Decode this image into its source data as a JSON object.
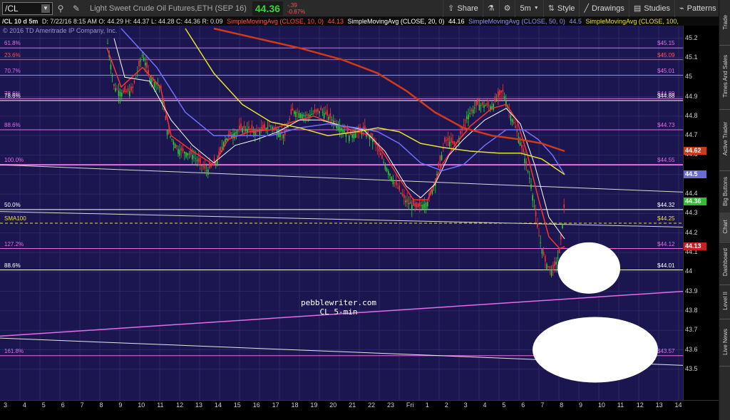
{
  "toolbar": {
    "symbol": "/CL",
    "description": "Light Sweet Crude Oil Futures,ETH (SEP 16)",
    "last": "44.36",
    "change": "-.39",
    "change_pct": "-0.87%",
    "buttons": [
      {
        "icon": "share-icon",
        "label": "Share"
      },
      {
        "icon": "flask-icon",
        "label": ""
      },
      {
        "icon": "gear-icon",
        "label": ""
      },
      {
        "icon": "timeframe",
        "label": "5m"
      },
      {
        "icon": "style-icon",
        "label": "Style"
      },
      {
        "icon": "drawings-icon",
        "label": "Drawings"
      },
      {
        "icon": "studies-icon",
        "label": "Studies"
      },
      {
        "icon": "patterns-icon",
        "label": "Patterns"
      }
    ]
  },
  "studyline": {
    "period": "/CL 10 d 5m",
    "ohlc": "D: 7/22/16 8:15 AM  O: 44.29  H: 44.37  L: 44.28  C: 44.36  R: 0.09",
    "sma10": "SimpleMovingAvg (CLOSE, 10, 0)",
    "sma10_val": "44.13",
    "sma20": "SimpleMovingAvg (CLOSE, 20, 0)",
    "sma20_val": "44.16",
    "sma50": "SimpleMovingAvg (CLOSE, 50, 0)",
    "sma50_val": "44.5",
    "sma100": "SimpleMovingAvg (CLOSE, 100,"
  },
  "copyright": "© 2016 TD Ameritrade IP Company, Inc.",
  "fib_levels": [
    {
      "label": "61.8%",
      "price": "$45.15",
      "color": "#e26de8"
    },
    {
      "label": "23.6%",
      "price": "$45.09",
      "color": "#ff5050"
    },
    {
      "label": "70.7%",
      "price": "$45.01",
      "color": "#e26de8"
    },
    {
      "label": "78.6%",
      "price": "$44.89",
      "color": "#e26de8"
    },
    {
      "label": "78.6%",
      "price": "$44.88",
      "color": "#ffffff"
    },
    {
      "label": "88.6%",
      "price": "$44.73",
      "color": "#e26de8"
    },
    {
      "label": "100.0%",
      "price": "$44.55",
      "color": "#e26de8"
    },
    {
      "label": "50.0%",
      "price": "$44.32",
      "color": "#ffffff"
    },
    {
      "label": "SMA100",
      "price": "$44.25",
      "color": "#e8e030"
    },
    {
      "label": "127.2%",
      "price": "$44.12",
      "color": "#e26de8"
    },
    {
      "label": "88.6%",
      "price": "$44.01",
      "color": "#ffffff"
    },
    {
      "label": "161.8%",
      "price": "$43.57",
      "color": "#e26de8"
    }
  ],
  "watermark": {
    "line1": "pebblewriter.com",
    "line2": "CL 5-min"
  },
  "price_axis": {
    "ticks": [
      "45.2",
      "45.1",
      "45",
      "44.9",
      "44.8",
      "44.7",
      "44.6",
      "44.5",
      "44.4",
      "44.3",
      "44.2",
      "44.1",
      "44",
      "43.9",
      "43.8",
      "43.7",
      "43.6",
      "43.5"
    ],
    "badges": [
      {
        "text": "44.62",
        "bg": "#d03a1a",
        "fg": "#ffffff"
      },
      {
        "text": "44.5",
        "bg": "#6a6ad8",
        "fg": "#ffffff"
      },
      {
        "text": "44.36",
        "bg": "#2fbf2f",
        "fg": "#ffffff"
      },
      {
        "text": "44.13",
        "bg": "#c82020",
        "fg": "#ffffff"
      }
    ]
  },
  "time_axis": [
    "3",
    "4",
    "5",
    "6",
    "7",
    "8",
    "9",
    "10",
    "11",
    "12",
    "13",
    "14",
    "15",
    "16",
    "17",
    "18",
    "19",
    "20",
    "21",
    "22",
    "23",
    "Fri",
    "1",
    "2",
    "3",
    "4",
    "5",
    "6",
    "7",
    "8",
    "9",
    "10",
    "11",
    "12",
    "13",
    "14"
  ],
  "sidebar": [
    "Trade",
    "Times And Sales",
    "Active Trader",
    "Big Buttons",
    "Chart",
    "Dashboard",
    "Level II",
    "Live News"
  ]
}
